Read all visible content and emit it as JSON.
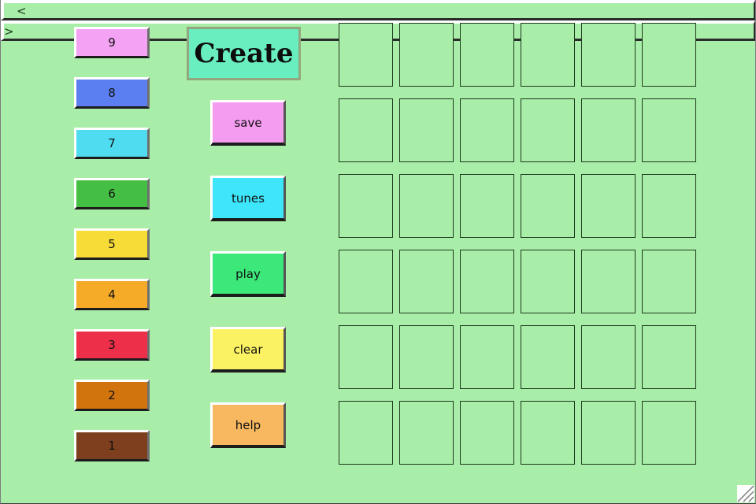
{
  "window": {
    "title": "Create",
    "background_color": "#a8eda8"
  },
  "navigation": {
    "prev": {
      "label": "<",
      "icon": "chevron-left-icon"
    },
    "next": {
      "label": ">",
      "icon": "chevron-right-icon"
    }
  },
  "create": {
    "label": "Create",
    "color": "#69eec0",
    "border_color": "#93a77f"
  },
  "note_buttons": [
    {
      "label": "9",
      "color": "#f4a3f4"
    },
    {
      "label": "8",
      "color": "#5b7ff0"
    },
    {
      "label": "7",
      "color": "#50dcf0"
    },
    {
      "label": "6",
      "color": "#44bf44"
    },
    {
      "label": "5",
      "color": "#f7dc38"
    },
    {
      "label": "4",
      "color": "#f5ab28"
    },
    {
      "label": "3",
      "color": "#ed2f4a"
    },
    {
      "label": "2",
      "color": "#d2740d"
    },
    {
      "label": "1",
      "color": "#7e3f1e"
    }
  ],
  "action_buttons": [
    {
      "label": "save",
      "color": "#f49cf0"
    },
    {
      "label": "tunes",
      "color": "#3de6fb"
    },
    {
      "label": "play",
      "color": "#3ce87a"
    },
    {
      "label": "clear",
      "color": "#fbf263"
    },
    {
      "label": "help",
      "color": "#f7b85f"
    }
  ],
  "grid": {
    "rows": 6,
    "columns": 6,
    "cell_border_color": "#1e3a1e",
    "cell_fill_color": "#a8eda8",
    "cells": [
      [
        "",
        "",
        "",
        "",
        "",
        ""
      ],
      [
        "",
        "",
        "",
        "",
        "",
        ""
      ],
      [
        "",
        "",
        "",
        "",
        "",
        ""
      ],
      [
        "",
        "",
        "",
        "",
        "",
        ""
      ],
      [
        "",
        "",
        "",
        "",
        "",
        ""
      ],
      [
        "",
        "",
        "",
        "",
        "",
        ""
      ]
    ]
  },
  "resize_grip": {
    "icon": "resize-grip-icon"
  }
}
